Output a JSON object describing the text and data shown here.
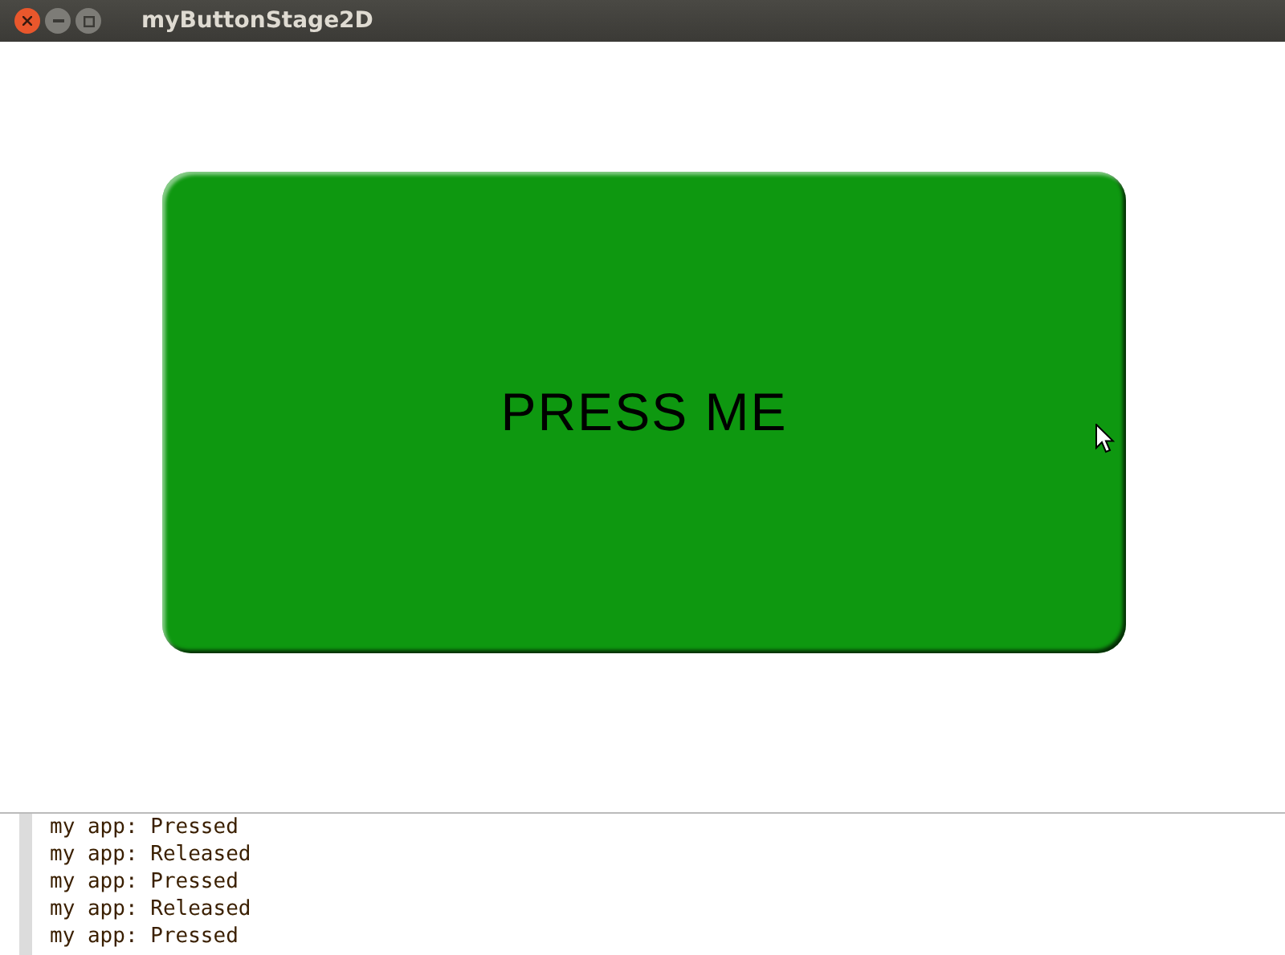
{
  "window": {
    "title": "myButtonStage2D"
  },
  "button": {
    "label": "PRESS ME"
  },
  "console": {
    "lines": [
      "my app: Pressed",
      "my app: Released",
      "my app: Pressed",
      "my app: Released",
      "my app: Pressed"
    ]
  }
}
